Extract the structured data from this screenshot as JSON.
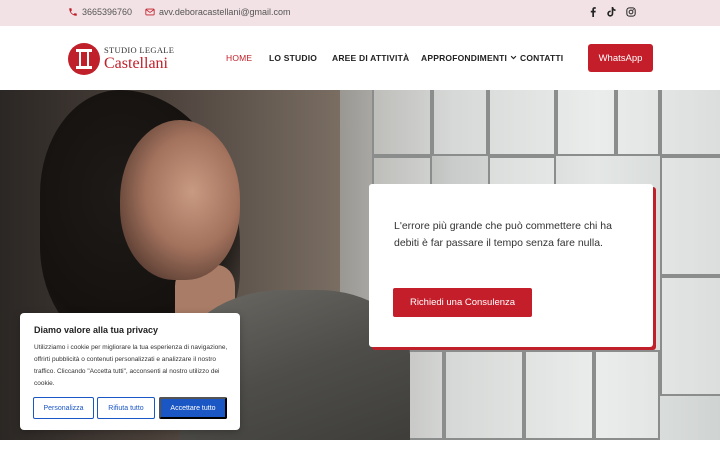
{
  "topbar": {
    "phone": "3665396760",
    "email": "avv.deboracastellani@gmail.com",
    "icons": {
      "phone": "phone-icon",
      "email": "envelope-icon",
      "social": [
        "facebook-icon",
        "tiktok-icon",
        "instagram-icon"
      ]
    }
  },
  "header": {
    "logo_top": "STUDIO LEGALE",
    "logo_name": "Castellani",
    "nav": [
      {
        "label": "HOME",
        "active": true
      },
      {
        "label": "LO STUDIO"
      },
      {
        "label": "AREE DI ATTIVITÀ"
      },
      {
        "label": "APPROFONDIMENTI",
        "has_dropdown": true
      },
      {
        "label": "CONTATTI"
      }
    ],
    "cta_label": "WhatsApp"
  },
  "hero": {
    "quote": "L'errore più grande che può commettere chi ha debiti è far passare il tempo senza fare nulla.",
    "button_label": "Richiedi una Consulenza"
  },
  "cookie_banner": {
    "title": "Diamo valore alla tua privacy",
    "text": "Utilizziamo i cookie per migliorare la tua esperienza di navigazione, offrirti pubblicità o contenuti personalizzati e analizzare il nostro traffico. Cliccando \"Accetta tutti\", acconsenti al nostro utilizzo dei cookie.",
    "buttons": {
      "customize": "Personalizza",
      "reject": "Rifiuta tutto",
      "accept": "Accettare tutto"
    }
  },
  "colors": {
    "brand_red": "#c41e2a",
    "topbar_bg": "#f2e2e5",
    "cookie_blue": "#1a56c4"
  }
}
